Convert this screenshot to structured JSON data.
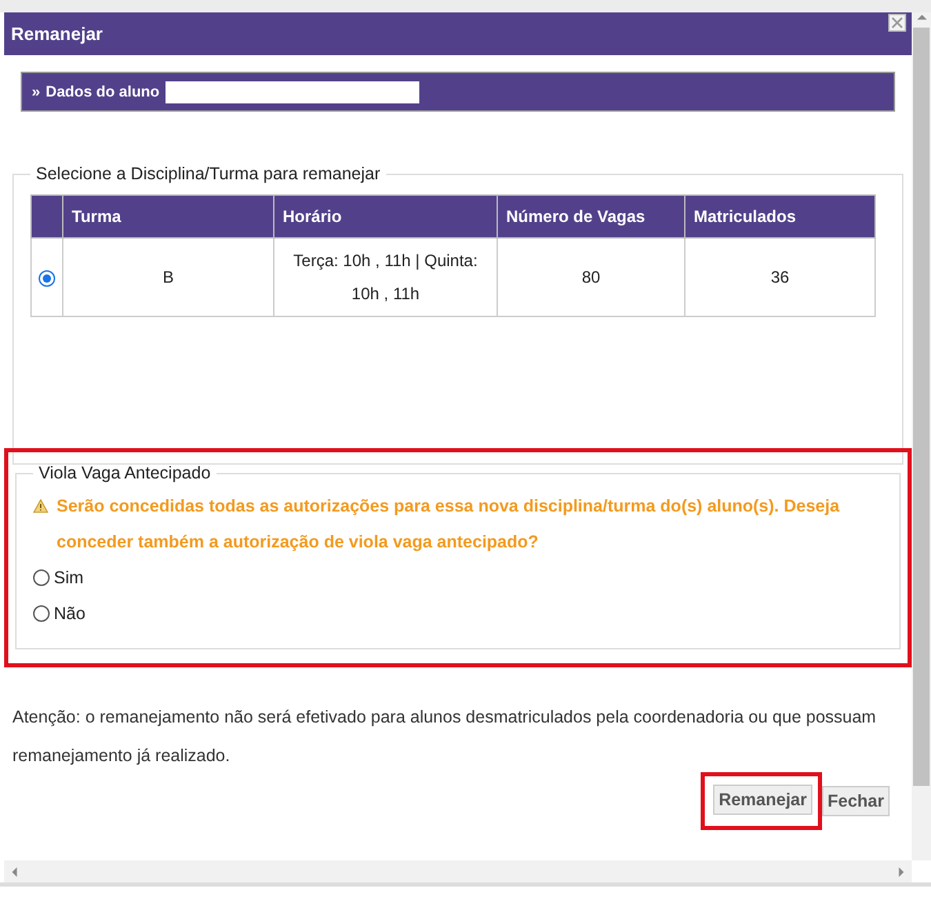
{
  "dialog": {
    "title": "Remanejar"
  },
  "student_bar": {
    "marker": "»",
    "label": "Dados do aluno"
  },
  "selection": {
    "legend": "Selecione a Disciplina/Turma para remanejar",
    "columns": [
      "Turma",
      "Horário",
      "Número de Vagas",
      "Matriculados"
    ],
    "rows": [
      {
        "selected": true,
        "cells": [
          "B",
          "Terça: 10h , 11h | Quinta: 10h , 11h",
          "80",
          "36"
        ]
      }
    ]
  },
  "viola": {
    "highlighted": true,
    "legend": "Viola Vaga Antecipado",
    "warning": "Serão concedidas todas as autorizações para essa nova disciplina/turma do(s) aluno(s). Deseja conceder também a autorização de viola vaga antecipado?",
    "options": [
      {
        "label": "Sim",
        "selected": false
      },
      {
        "label": "Não",
        "selected": false
      }
    ]
  },
  "notice": "Atenção: o remanejamento não será efetivado para alunos desmatriculados pela coordenadoria ou que possuam remanejamento já realizado.",
  "buttons": [
    {
      "label": "Remanejar",
      "highlighted": true
    },
    {
      "label": "Fechar",
      "highlighted": false
    }
  ]
}
